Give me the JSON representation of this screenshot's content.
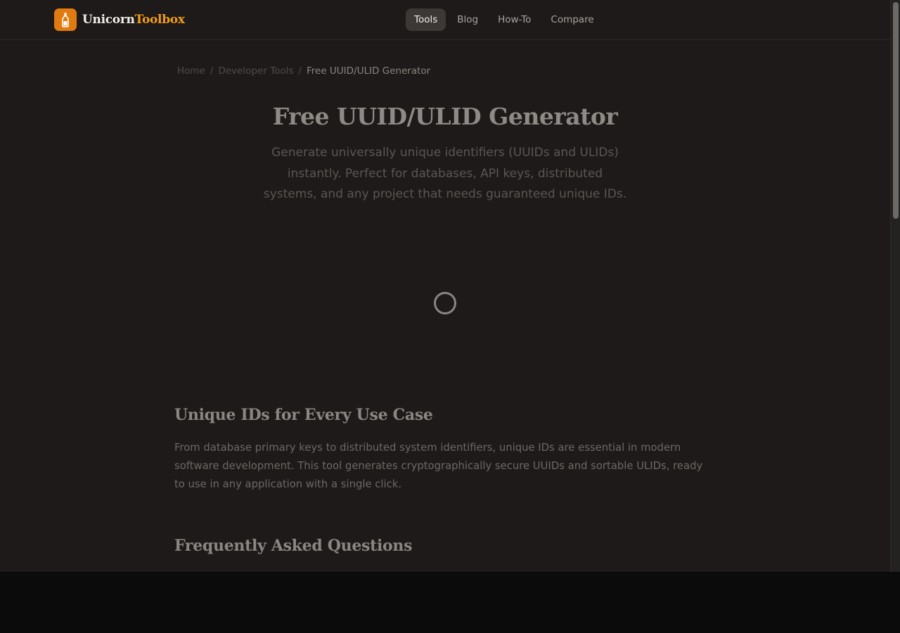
{
  "brand": {
    "name_part1": "Unicorn",
    "name_part2": "Toolbox",
    "icon": "bottle-icon"
  },
  "nav": {
    "items": [
      {
        "label": "Tools",
        "active": true
      },
      {
        "label": "Blog",
        "active": false
      },
      {
        "label": "How-To",
        "active": false
      },
      {
        "label": "Compare",
        "active": false
      }
    ]
  },
  "breadcrumb": {
    "home": "Home",
    "category": "Developer Tools",
    "current": "Free UUID/ULID Generator",
    "separator": "/"
  },
  "hero": {
    "title": "Free UUID/ULID Generator",
    "subtitle": "Generate universally unique identifiers (UUIDs and ULIDs) instantly. Perfect for databases, API keys, distributed systems, and any project that needs guaranteed unique IDs."
  },
  "loading": {
    "icon": "loading-spinner-icon"
  },
  "sections": {
    "use_cases": {
      "title": "Unique IDs for Every Use Case",
      "body": "From database primary keys to distributed system identifiers, unique IDs are essential in modern software development. This tool generates cryptographically secure UUIDs and sortable ULIDs, ready to use in any application with a single click."
    },
    "faq": {
      "title": "Frequently Asked Questions"
    }
  },
  "colors": {
    "accent": "#e17b10",
    "brand_highlight": "#f39c1a",
    "background": "#1d1a19"
  }
}
